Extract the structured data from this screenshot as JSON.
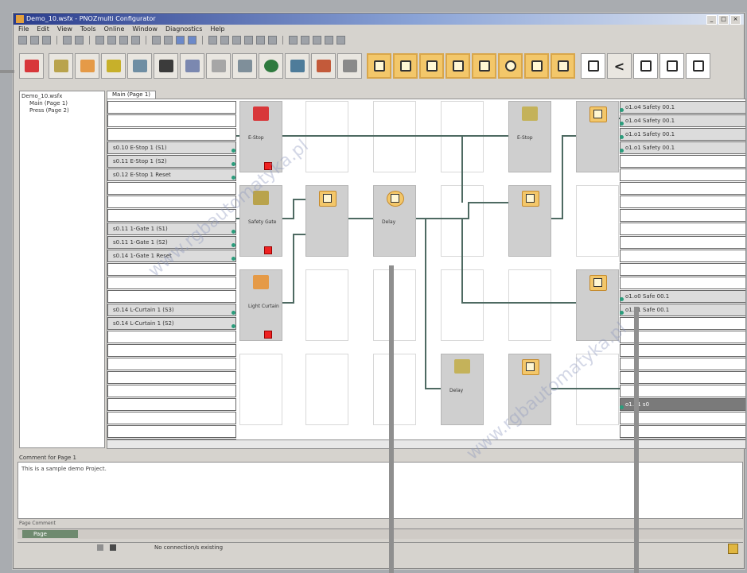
{
  "window": {
    "title": "Demo_10.wsfx - PNOZmulti Configurator",
    "controls": [
      "_",
      "□",
      "×"
    ]
  },
  "menu": [
    "File",
    "Edit",
    "View",
    "Tools",
    "Online",
    "Window",
    "Diagnostics",
    "Help"
  ],
  "tree": {
    "root": "Demo_10.wsfx",
    "items": [
      "Main (Page 1)",
      "Press (Page 2)"
    ]
  },
  "editor_tab": "Main (Page 1)",
  "inputs": [
    "",
    "",
    "",
    "s0.10 E-Stop 1 (S1)",
    "s0.11 E-Stop 1 (S2)",
    "s0.12 E-Stop 1 Reset",
    "",
    "",
    "",
    "s0.11 1-Gate 1 (S1)",
    "s0.11 1-Gate 1 (S2)",
    "s0.14 1-Gate 1 Reset",
    "",
    "",
    "",
    "s0.14 L-Curtain 1 (S3)",
    "s0.14 L-Curtain 1 (S2)",
    "",
    "",
    "",
    "",
    "",
    "",
    "",
    "",
    ""
  ],
  "outputs": [
    "o1.o4 Safety 00.1",
    "o1.o4 Safety 00.1",
    "o1.o1 Safety 00.1",
    "o1.o1 Safety 00.1",
    "",
    "",
    "",
    "",
    "",
    "",
    "",
    "",
    "",
    "",
    "o1.o0 Safe 00.1",
    "o1.o1 Safe 00.1",
    "",
    "",
    "",
    "",
    "",
    "",
    "o1.o1 s0",
    "",
    "",
    ""
  ],
  "blocks": {
    "estop_label": "E-Stop",
    "gate_label": "Safety Gate",
    "curtain_label": "Light Curtain",
    "timer_label": "Delay",
    "and_label": "",
    "reset_label": "",
    "or_label": "",
    "out_label": "",
    "delay_label": "Delay",
    "counter_label": "E-Stop"
  },
  "comment": {
    "header": "Comment for Page 1",
    "text": "This is a sample demo Project."
  },
  "page_comment": "Page Comment",
  "bottom_tab": "Page",
  "status": {
    "text": "No connection/s existing"
  }
}
